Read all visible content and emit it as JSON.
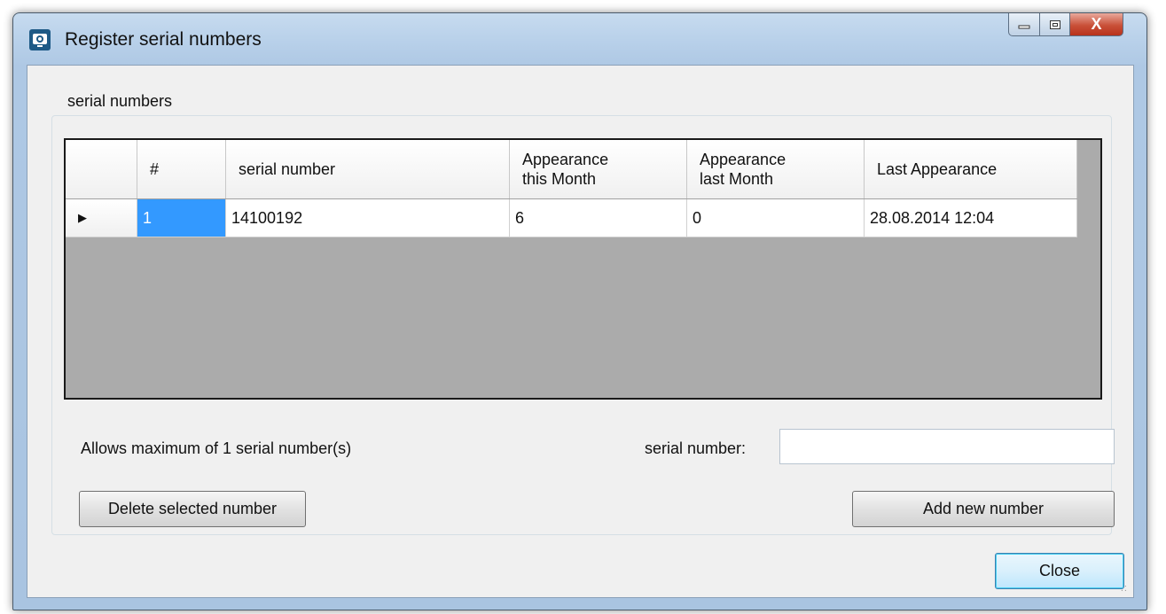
{
  "window": {
    "title": "Register serial numbers",
    "close_glyph": "X"
  },
  "group": {
    "label": "serial numbers"
  },
  "table": {
    "columns": [
      "#",
      "serial number",
      "Appearance\nthis Month",
      "Appearance\nlast Month",
      "Last Appearance"
    ],
    "rows": [
      {
        "marker": "▶",
        "num": "1",
        "serial": "14100192",
        "this_month": "6",
        "last_month": "0",
        "last_appearance": "28.08.2014 12:04"
      }
    ]
  },
  "info": {
    "max_label": "Allows maximum of 1 serial number(s)"
  },
  "input": {
    "label": "serial number:",
    "value": ""
  },
  "buttons": {
    "delete": "Delete selected number",
    "add": "Add new number",
    "close": "Close"
  },
  "icons": {
    "app": "app-icon",
    "minimize": "minimize-icon",
    "maximize": "maximize-icon",
    "close": "close-icon",
    "row_marker": "row-pointer-icon",
    "grip": "resize-grip-icon"
  }
}
